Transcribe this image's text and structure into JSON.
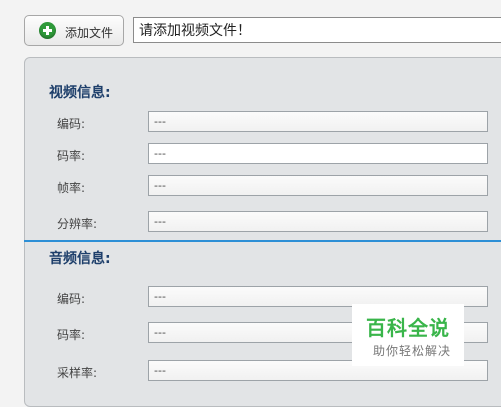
{
  "toolbar": {
    "add_file_label": "添加文件",
    "file_path_value": "请添加视频文件！"
  },
  "video_info": {
    "title": "视频信息:",
    "codec_label": "编码:",
    "codec_value": "---",
    "bitrate_label": "码率:",
    "bitrate_value": "---",
    "framerate_label": "帧率:",
    "framerate_value": "---",
    "resolution_label": "分辨率:",
    "resolution_value": "---"
  },
  "audio_info": {
    "title": "音频信息:",
    "codec_label": "编码:",
    "codec_value": "---",
    "bitrate_label": "码率:",
    "bitrate_value": "---",
    "samplerate_label": "采样率:",
    "samplerate_value": "---"
  },
  "watermark": {
    "logo_text": "百科全说",
    "tagline": "助你轻松解决"
  },
  "colors": {
    "accent_divider": "#2d8fd6",
    "add_icon": "#2f9a3a",
    "section_title": "#1e3f6b",
    "watermark_green": "#39b54a"
  }
}
